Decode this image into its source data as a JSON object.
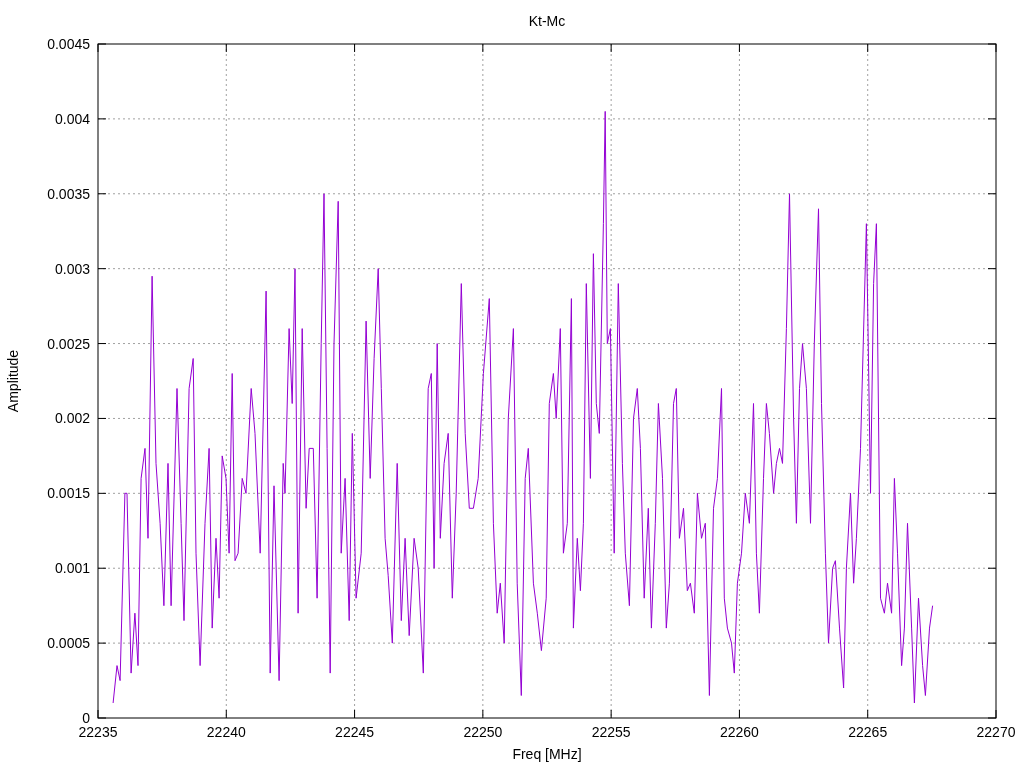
{
  "chart_data": {
    "type": "line",
    "title": "Kt-Mc",
    "xlabel": "Freq [MHz]",
    "ylabel": "Amplitude",
    "grid": true,
    "xlim": [
      22235,
      22270
    ],
    "ylim": [
      0,
      0.0045
    ],
    "xticks": [
      22235,
      22240,
      22245,
      22250,
      22255,
      22260,
      22265,
      22270
    ],
    "yticks": [
      {
        "value": 0,
        "label": "0"
      },
      {
        "value": 0.0005,
        "label": "0.0005"
      },
      {
        "value": 0.001,
        "label": "0.001"
      },
      {
        "value": 0.0015,
        "label": "0.0015"
      },
      {
        "value": 0.002,
        "label": "0.002"
      },
      {
        "value": 0.0025,
        "label": "0.0025"
      },
      {
        "value": 0.003,
        "label": "0.003"
      },
      {
        "value": 0.0035,
        "label": "0.0035"
      },
      {
        "value": 0.004,
        "label": "0.004"
      },
      {
        "value": 0.0045,
        "label": "0.0045"
      }
    ],
    "x": [
      22235.59,
      22235.74,
      22235.86,
      22236.05,
      22236.13,
      22236.29,
      22236.44,
      22236.56,
      22236.68,
      22236.83,
      22236.95,
      22237.11,
      22237.26,
      22237.42,
      22237.57,
      22237.73,
      22237.85,
      22238.08,
      22238.24,
      22238.35,
      22238.55,
      22238.71,
      22238.82,
      22238.98,
      22239.17,
      22239.33,
      22239.45,
      22239.6,
      22239.72,
      22239.84,
      22239.99,
      22240.11,
      22240.23,
      22240.34,
      22240.46,
      22240.62,
      22240.77,
      22240.97,
      22241.12,
      22241.32,
      22241.55,
      22241.71,
      22241.86,
      22242.06,
      22242.22,
      22242.29,
      22242.45,
      22242.57,
      22242.68,
      22242.8,
      22242.96,
      22243.11,
      22243.23,
      22243.39,
      22243.54,
      22243.7,
      22243.81,
      22243.93,
      22244.05,
      22244.2,
      22244.36,
      22244.48,
      22244.63,
      22244.79,
      22244.91,
      22245.06,
      22245.26,
      22245.45,
      22245.61,
      22245.76,
      22245.92,
      22246.04,
      22246.19,
      22246.31,
      22246.47,
      22246.66,
      22246.82,
      22246.97,
      22247.13,
      22247.32,
      22247.48,
      22247.68,
      22247.87,
      22247.99,
      22248.1,
      22248.22,
      22248.34,
      22248.49,
      22248.65,
      22248.81,
      22248.96,
      22249.16,
      22249.31,
      22249.47,
      22249.63,
      22249.82,
      22250.02,
      22250.25,
      22250.41,
      22250.56,
      22250.68,
      22250.83,
      22250.99,
      22251.19,
      22251.34,
      22251.5,
      22251.65,
      22251.77,
      22251.97,
      22252.12,
      22252.28,
      22252.47,
      22252.59,
      22252.75,
      22252.86,
      22253.02,
      22253.14,
      22253.29,
      22253.45,
      22253.53,
      22253.68,
      22253.8,
      22253.92,
      22254.03,
      22254.19,
      22254.31,
      22254.42,
      22254.54,
      22254.7,
      22254.77,
      22254.85,
      22254.97,
      22255.12,
      22255.28,
      22255.44,
      22255.55,
      22255.71,
      22255.87,
      22256.02,
      22256.14,
      22256.29,
      22256.45,
      22256.57,
      22256.72,
      22256.84,
      22257,
      22257.15,
      22257.27,
      22257.43,
      22257.54,
      22257.66,
      22257.82,
      22257.97,
      22258.09,
      22258.24,
      22258.36,
      22258.52,
      22258.67,
      22258.83,
      22258.99,
      22259.14,
      22259.3,
      22259.41,
      22259.53,
      22259.69,
      22259.8,
      22259.92,
      22260.08,
      22260.23,
      22260.39,
      22260.55,
      22260.66,
      22260.78,
      22260.94,
      22261.05,
      22261.17,
      22261.33,
      22261.44,
      22261.56,
      22261.68,
      22261.83,
      22261.95,
      22262.11,
      22262.22,
      22262.34,
      22262.46,
      22262.61,
      22262.77,
      22262.92,
      22263.08,
      22263.2,
      22263.35,
      22263.47,
      22263.63,
      22263.74,
      22263.9,
      22264.06,
      22264.17,
      22264.33,
      22264.45,
      22264.56,
      22264.72,
      22264.95,
      22265.11,
      22265.23,
      22265.34,
      22265.5,
      22265.65,
      22265.77,
      22265.93,
      22266.04,
      22266.16,
      22266.32,
      22266.43,
      22266.55,
      22266.71,
      22266.82,
      22266.98,
      22267.14,
      22267.25,
      22267.41,
      22267.53
    ],
    "series": [
      {
        "color": "#9400d3",
        "values": [
          0.0001,
          0.00035,
          0.00025,
          0.0015,
          0.0015,
          0.0003,
          0.0007,
          0.00035,
          0.0016,
          0.0018,
          0.0012,
          0.00295,
          0.0017,
          0.0013,
          0.00075,
          0.0017,
          0.00075,
          0.0022,
          0.0013,
          0.00065,
          0.0022,
          0.0024,
          0.0011,
          0.00035,
          0.0013,
          0.0018,
          0.0006,
          0.0012,
          0.0008,
          0.00175,
          0.0016,
          0.0011,
          0.0023,
          0.00105,
          0.0011,
          0.0016,
          0.0015,
          0.0022,
          0.0019,
          0.0011,
          0.00285,
          0.0003,
          0.00155,
          0.00025,
          0.0017,
          0.0015,
          0.0026,
          0.0021,
          0.003,
          0.0007,
          0.0026,
          0.0014,
          0.0018,
          0.0018,
          0.0008,
          0.0025,
          0.0035,
          0.0018,
          0.0003,
          0.0025,
          0.00345,
          0.0011,
          0.0016,
          0.00065,
          0.0019,
          0.0008,
          0.0011,
          0.00265,
          0.0016,
          0.0024,
          0.003,
          0.0022,
          0.0012,
          0.00095,
          0.0005,
          0.0017,
          0.00065,
          0.0012,
          0.00055,
          0.0012,
          0.001,
          0.0003,
          0.0022,
          0.0023,
          0.001,
          0.0025,
          0.0012,
          0.0017,
          0.0019,
          0.0008,
          0.0015,
          0.0029,
          0.0019,
          0.0014,
          0.0014,
          0.0016,
          0.0023,
          0.0028,
          0.0013,
          0.0007,
          0.0009,
          0.0005,
          0.002,
          0.0026,
          0.0009,
          0.00015,
          0.0016,
          0.0018,
          0.0009,
          0.0007,
          0.00045,
          0.0008,
          0.0021,
          0.0023,
          0.002,
          0.0026,
          0.0011,
          0.0013,
          0.0028,
          0.0006,
          0.0012,
          0.00085,
          0.0013,
          0.0029,
          0.0016,
          0.0031,
          0.0021,
          0.0019,
          0.0033,
          0.00405,
          0.0025,
          0.0026,
          0.0011,
          0.0029,
          0.0017,
          0.0011,
          0.00075,
          0.002,
          0.0022,
          0.0018,
          0.0008,
          0.0014,
          0.0006,
          0.0013,
          0.0021,
          0.0016,
          0.0006,
          0.0009,
          0.0021,
          0.0022,
          0.0012,
          0.0014,
          0.00085,
          0.0009,
          0.0007,
          0.0015,
          0.0012,
          0.0013,
          0.00015,
          0.0014,
          0.0016,
          0.0022,
          0.0008,
          0.0006,
          0.0005,
          0.0003,
          0.0009,
          0.0011,
          0.0015,
          0.0013,
          0.0021,
          0.0011,
          0.0007,
          0.0016,
          0.0021,
          0.0019,
          0.0015,
          0.0017,
          0.0018,
          0.0017,
          0.0026,
          0.0035,
          0.002,
          0.0013,
          0.0022,
          0.0025,
          0.0022,
          0.0013,
          0.0025,
          0.0034,
          0.0021,
          0.0011,
          0.0005,
          0.001,
          0.00105,
          0.0006,
          0.0002,
          0.001,
          0.0015,
          0.0009,
          0.0012,
          0.0018,
          0.0033,
          0.0015,
          0.0029,
          0.0033,
          0.0008,
          0.0007,
          0.0009,
          0.0007,
          0.0016,
          0.0011,
          0.00035,
          0.0006,
          0.0013,
          0.0006,
          0.0001,
          0.0008,
          0.00035,
          0.00015,
          0.0006,
          0.00075
        ]
      }
    ]
  }
}
